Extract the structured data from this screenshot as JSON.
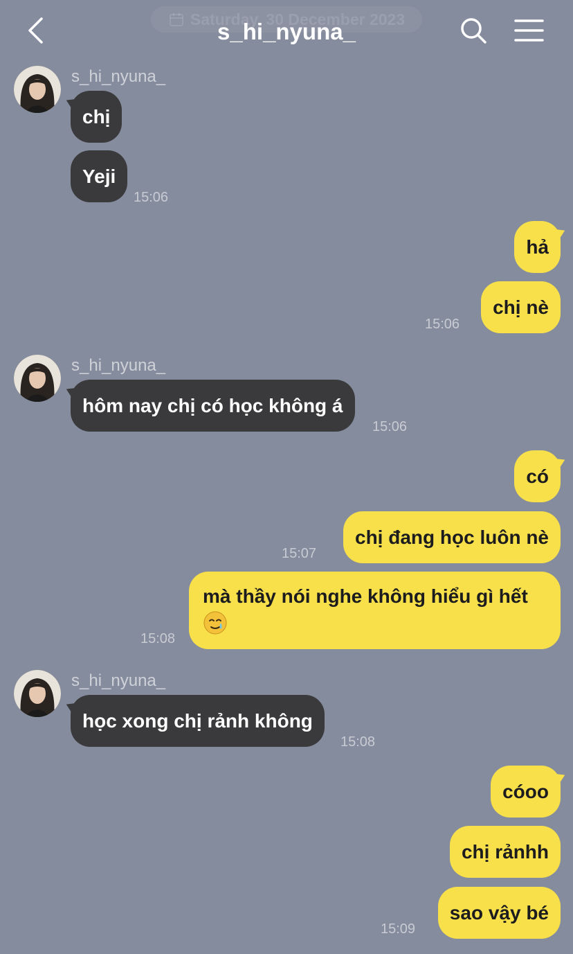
{
  "header": {
    "date": "Saturday, 30 December 2023",
    "title": "s_hi_nyuna_",
    "icons": [
      "back-arrow-icon",
      "search-icon",
      "menu-icon"
    ]
  },
  "colors": {
    "background": "#858c9d",
    "incoming_bubble": "#3a3a3c",
    "outgoing_bubble": "#f7e04a"
  },
  "messages": {
    "group1": {
      "sender": "s_hi_nyuna_",
      "m1": "chị",
      "m2": "Yeji",
      "time": "15:06"
    },
    "group2": {
      "m1": "hả",
      "m2": "chị nè",
      "time": "15:06"
    },
    "group3": {
      "sender": "s_hi_nyuna_",
      "m1": "hôm nay chị có học không á",
      "time": "15:06"
    },
    "group4": {
      "m1": "có",
      "m2": "chị đang học luôn nè",
      "m3": "mà thầy nói nghe không hiểu gì hết",
      "m3_emoji": "crying-smile-emoji",
      "time": "15:08",
      "time_m2": "15:07"
    },
    "group5": {
      "sender": "s_hi_nyuna_",
      "m1": "học xong chị rảnh không",
      "time": "15:08"
    },
    "group6": {
      "m1": "cóoo",
      "m2": "chị rảnhh",
      "m3": "sao vậy bé",
      "time": "15:09"
    }
  }
}
